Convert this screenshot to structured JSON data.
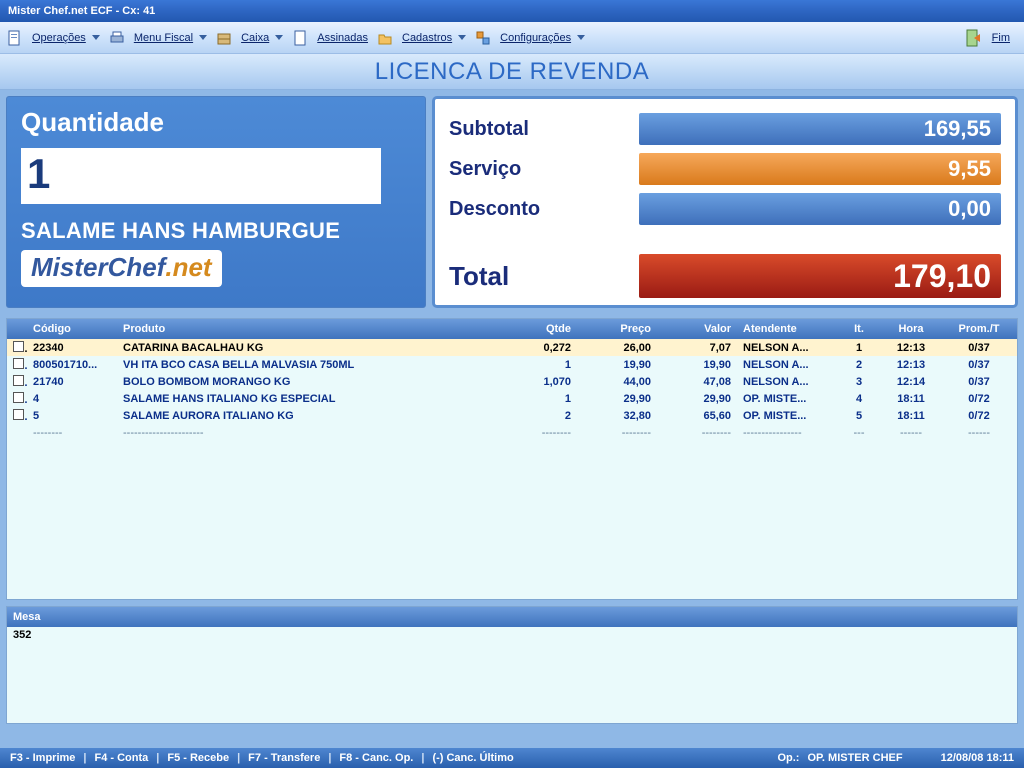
{
  "window": {
    "title": "Mister Chef.net ECF - Cx: 41"
  },
  "menu": {
    "operacoes": "Operações",
    "fiscal": "Menu Fiscal",
    "caixa": "Caixa",
    "assinadas": "Assinadas",
    "cadastros": "Cadastros",
    "config": "Configurações",
    "fim": "Fim"
  },
  "banner": "LICENCA DE REVENDA",
  "qty": {
    "label": "Quantidade",
    "value": "1",
    "item": "SALAME HANS HAMBURGUE",
    "logo_a": "MisterChef",
    "logo_b": ".net"
  },
  "totals": {
    "subtotal_lbl": "Subtotal",
    "subtotal_val": "169,55",
    "servico_lbl": "Serviço",
    "servico_val": "9,55",
    "desconto_lbl": "Desconto",
    "desconto_val": "0,00",
    "total_lbl": "Total",
    "total_val": "179,10"
  },
  "grid": {
    "headers": {
      "codigo": "Código",
      "produto": "Produto",
      "qtde": "Qtde",
      "preco": "Preço",
      "valor": "Valor",
      "atendente": "Atendente",
      "it": "It.",
      "hora": "Hora",
      "prom": "Prom./T"
    },
    "rows": [
      {
        "codigo": "22340",
        "produto": "CATARINA BACALHAU KG",
        "qtde": "0,272",
        "preco": "26,00",
        "valor": "7,07",
        "atendente": "NELSON A...",
        "it": "1",
        "hora": "12:13",
        "prom": "0/37"
      },
      {
        "codigo": "800501710...",
        "produto": "VH ITA BCO CASA BELLA MALVASIA 750ML",
        "qtde": "1",
        "preco": "19,90",
        "valor": "19,90",
        "atendente": "NELSON A...",
        "it": "2",
        "hora": "12:13",
        "prom": "0/37"
      },
      {
        "codigo": "21740",
        "produto": "BOLO BOMBOM MORANGO KG",
        "qtde": "1,070",
        "preco": "44,00",
        "valor": "47,08",
        "atendente": "NELSON A...",
        "it": "3",
        "hora": "12:14",
        "prom": "0/37"
      },
      {
        "codigo": "4",
        "produto": "SALAME HANS ITALIANO KG ESPECIAL",
        "qtde": "1",
        "preco": "29,90",
        "valor": "29,90",
        "atendente": "OP. MISTE...",
        "it": "4",
        "hora": "18:11",
        "prom": "0/72"
      },
      {
        "codigo": "5",
        "produto": "SALAME AURORA ITALIANO KG",
        "qtde": "2",
        "preco": "32,80",
        "valor": "65,60",
        "atendente": "OP. MISTE...",
        "it": "5",
        "hora": "18:11",
        "prom": "0/72"
      }
    ],
    "dashes": "--------"
  },
  "mesa": {
    "header": "Mesa",
    "value": "352"
  },
  "status": {
    "f3": "F3 - Imprime",
    "f4": "F4 - Conta",
    "f5": "F5 - Recebe",
    "f7": "F7 - Transfere",
    "f8": "F8 - Canc. Op.",
    "canc": "(-) Canc. Último",
    "op_lbl": "Op.:",
    "op_val": "OP. MISTER CHEF",
    "datetime": "12/08/08 18:11"
  }
}
